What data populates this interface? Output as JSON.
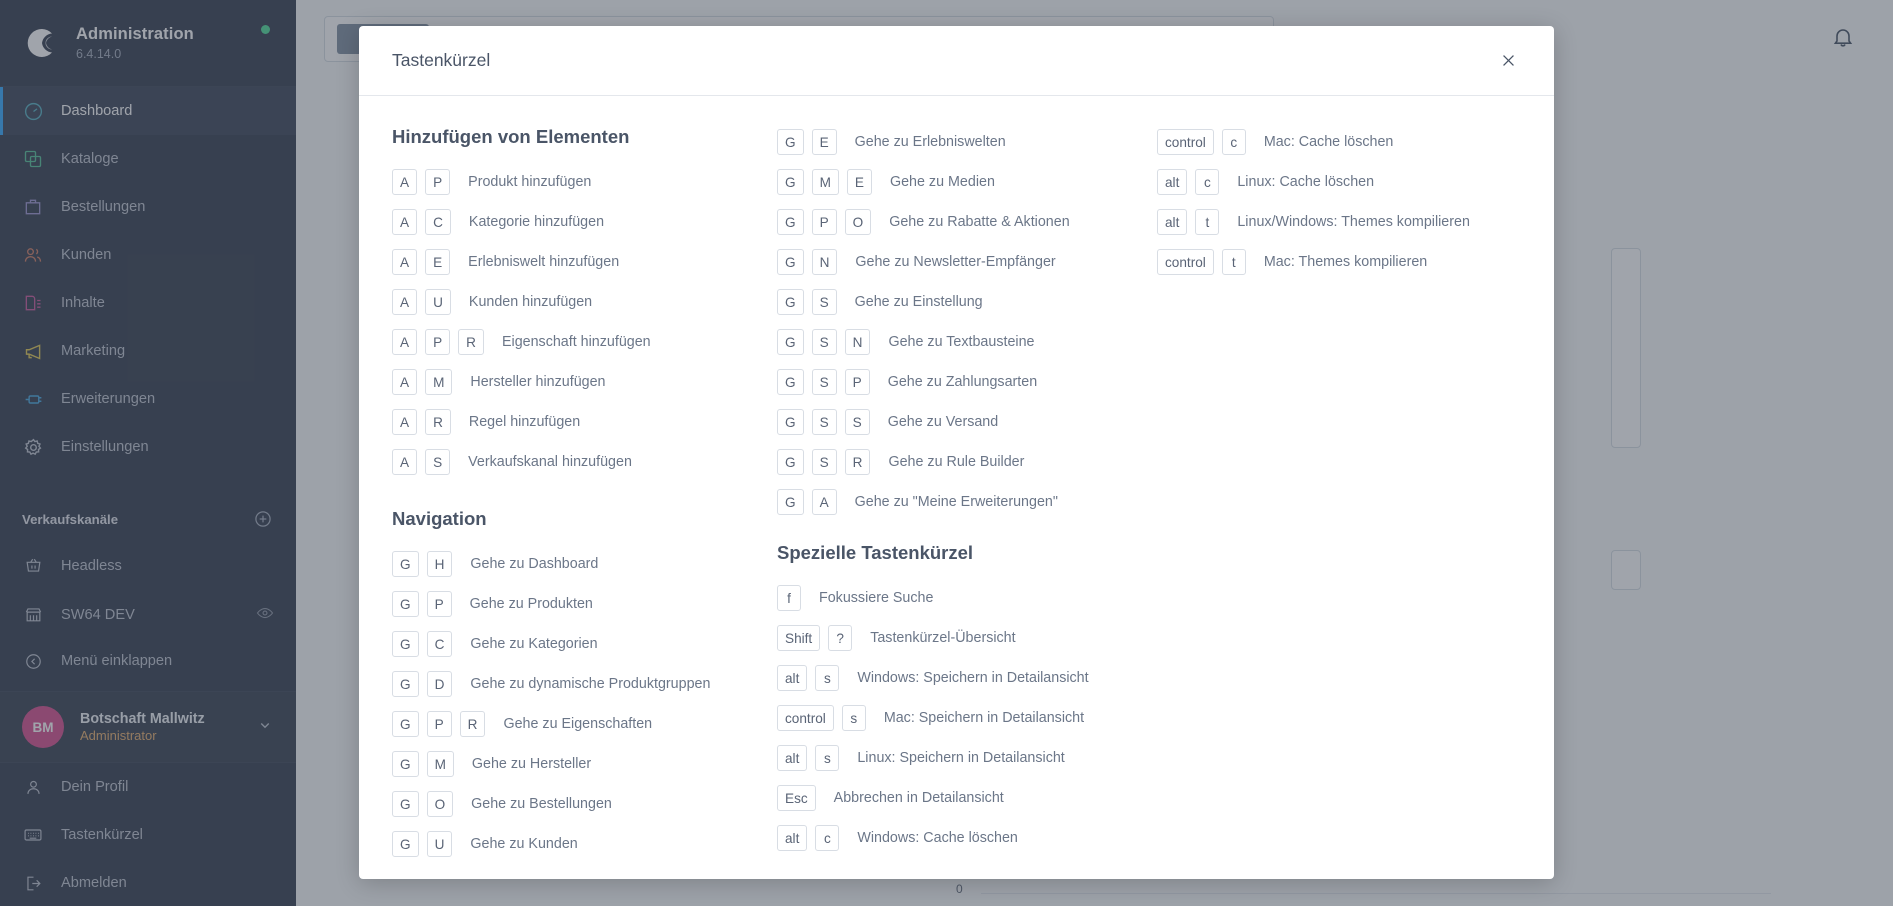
{
  "sidebar": {
    "brand": {
      "title": "Administration",
      "version": "6.4.14.0"
    },
    "nav": [
      {
        "label": "Dashboard",
        "icon": "dashboard-icon",
        "active": true
      },
      {
        "label": "Kataloge",
        "icon": "catalog-icon",
        "active": false
      },
      {
        "label": "Bestellungen",
        "icon": "orders-icon",
        "active": false
      },
      {
        "label": "Kunden",
        "icon": "customers-icon",
        "active": false
      },
      {
        "label": "Inhalte",
        "icon": "content-icon",
        "active": false
      },
      {
        "label": "Marketing",
        "icon": "marketing-icon",
        "active": false
      },
      {
        "label": "Erweiterungen",
        "icon": "extensions-icon",
        "active": false
      },
      {
        "label": "Einstellungen",
        "icon": "settings-gear-icon",
        "active": false
      }
    ],
    "channels_heading": "Verkaufskanäle",
    "channels": [
      {
        "label": "Headless",
        "icon": "basket-icon"
      },
      {
        "label": "SW64 DEV",
        "icon": "storefront-icon"
      }
    ],
    "collapse_label": "Menü einklappen",
    "user": {
      "initials": "BM",
      "name": "Botschaft Mallwitz",
      "role": "Administrator"
    },
    "footer": [
      {
        "label": "Dein Profil",
        "icon": "user-icon"
      },
      {
        "label": "Tastenkürzel",
        "icon": "keyboard-icon"
      },
      {
        "label": "Abmelden",
        "icon": "logout-icon"
      }
    ]
  },
  "main": {
    "chart_zero_label": "0"
  },
  "modal": {
    "title": "Tastenkürzel",
    "close_label": "×",
    "sections": [
      {
        "heading": "Hinzufügen von Elementen",
        "items": [
          {
            "keys": [
              "A",
              "P"
            ],
            "label": "Produkt hinzufügen"
          },
          {
            "keys": [
              "A",
              "C"
            ],
            "label": "Kategorie hinzufügen"
          },
          {
            "keys": [
              "A",
              "E"
            ],
            "label": "Erlebniswelt hinzufügen"
          },
          {
            "keys": [
              "A",
              "U"
            ],
            "label": "Kunden hinzufügen"
          },
          {
            "keys": [
              "A",
              "P",
              "R"
            ],
            "label": "Eigenschaft hinzufügen"
          },
          {
            "keys": [
              "A",
              "M"
            ],
            "label": "Hersteller hinzufügen"
          },
          {
            "keys": [
              "A",
              "R"
            ],
            "label": "Regel hinzufügen"
          },
          {
            "keys": [
              "A",
              "S"
            ],
            "label": "Verkaufskanal hinzufügen"
          }
        ]
      },
      {
        "heading": "Navigation",
        "items": [
          {
            "keys": [
              "G",
              "H"
            ],
            "label": "Gehe zu Dashboard"
          },
          {
            "keys": [
              "G",
              "P"
            ],
            "label": "Gehe zu Produkten"
          },
          {
            "keys": [
              "G",
              "C"
            ],
            "label": "Gehe zu Kategorien"
          },
          {
            "keys": [
              "G",
              "D"
            ],
            "label": "Gehe zu dynamische Produktgruppen"
          },
          {
            "keys": [
              "G",
              "P",
              "R"
            ],
            "label": "Gehe zu Eigenschaften"
          },
          {
            "keys": [
              "G",
              "M"
            ],
            "label": "Gehe zu Hersteller"
          },
          {
            "keys": [
              "G",
              "O"
            ],
            "label": "Gehe zu Bestellungen"
          },
          {
            "keys": [
              "G",
              "U"
            ],
            "label": "Gehe zu Kunden"
          }
        ]
      },
      {
        "heading": "",
        "items": [
          {
            "keys": [
              "G",
              "E"
            ],
            "label": "Gehe zu Erlebniswelten"
          },
          {
            "keys": [
              "G",
              "M",
              "E"
            ],
            "label": "Gehe zu Medien"
          },
          {
            "keys": [
              "G",
              "P",
              "O"
            ],
            "label": "Gehe zu Rabatte & Aktionen"
          },
          {
            "keys": [
              "G",
              "N"
            ],
            "label": "Gehe zu Newsletter-Empfänger"
          },
          {
            "keys": [
              "G",
              "S"
            ],
            "label": "Gehe zu Einstellung"
          },
          {
            "keys": [
              "G",
              "S",
              "N"
            ],
            "label": "Gehe zu Textbausteine"
          },
          {
            "keys": [
              "G",
              "S",
              "P"
            ],
            "label": "Gehe zu Zahlungsarten"
          },
          {
            "keys": [
              "G",
              "S",
              "S"
            ],
            "label": "Gehe zu Versand"
          },
          {
            "keys": [
              "G",
              "S",
              "R"
            ],
            "label": "Gehe zu Rule Builder"
          },
          {
            "keys": [
              "G",
              "A"
            ],
            "label": "Gehe zu \"Meine Erweiterungen\""
          }
        ]
      },
      {
        "heading": "Spezielle Tastenkürzel",
        "items": [
          {
            "keys": [
              "f"
            ],
            "label": "Fokussiere Suche"
          },
          {
            "keys": [
              "Shift",
              "?"
            ],
            "label": "Tastenkürzel-Übersicht"
          },
          {
            "keys": [
              "alt",
              "s"
            ],
            "label": "Windows: Speichern in Detailansicht"
          },
          {
            "keys": [
              "control",
              "s"
            ],
            "label": "Mac: Speichern in Detailansicht"
          },
          {
            "keys": [
              "alt",
              "s"
            ],
            "label": "Linux: Speichern in Detailansicht"
          },
          {
            "keys": [
              "Esc"
            ],
            "label": "Abbrechen in Detailansicht"
          },
          {
            "keys": [
              "alt",
              "c"
            ],
            "label": "Windows: Cache löschen"
          }
        ]
      },
      {
        "heading": "",
        "items": [
          {
            "keys": [
              "control",
              "c"
            ],
            "label": "Mac: Cache löschen"
          },
          {
            "keys": [
              "alt",
              "c"
            ],
            "label": "Linux: Cache löschen"
          },
          {
            "keys": [
              "alt",
              "t"
            ],
            "label": "Linux/Windows: Themes kompilieren"
          },
          {
            "keys": [
              "control",
              "t"
            ],
            "label": "Mac: Themes kompilieren"
          }
        ]
      }
    ]
  },
  "colors": {
    "sidebar_bg": "#182235",
    "sidebar_active": "#1f2b40",
    "accent_blue": "#189eff",
    "avatar_pink": "#d1377f",
    "role_orange": "#e5a55a",
    "status_green": "#37d88b",
    "key_border": "#d8dde4",
    "text_muted": "#6b7688"
  }
}
